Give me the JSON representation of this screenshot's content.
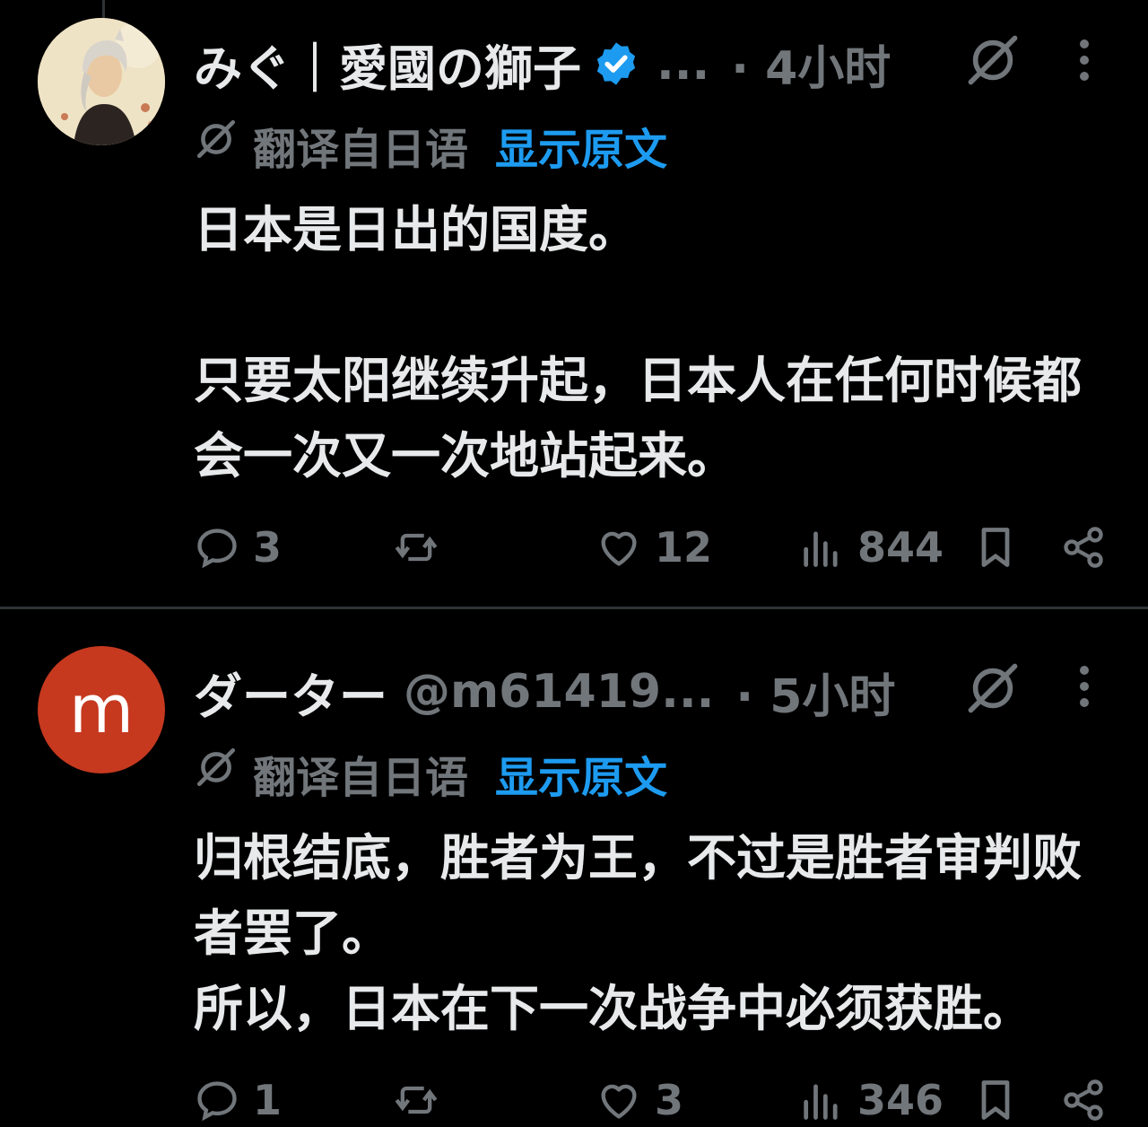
{
  "posts": [
    {
      "display_name": "みぐ｜愛國の獅子",
      "verified": true,
      "handle": "...",
      "timestamp": "· 4小时",
      "avatar_letter": "",
      "translated_label": "翻译自日语",
      "show_original_label": "显示原文",
      "paragraphs": [
        [
          "日本是日出的国度。"
        ],
        [
          "只要太阳继续升起，日本人在任何时候都",
          "会一次又一次地站起来。"
        ]
      ],
      "replies": "3",
      "reposts": "",
      "likes": "12",
      "views": "844"
    },
    {
      "display_name": "ダーター",
      "verified": false,
      "handle": "@m61419...",
      "timestamp": "· 5小时",
      "avatar_letter": "m",
      "translated_label": "翻译自日语",
      "show_original_label": "显示原文",
      "paragraphs": [
        [
          "归根结底，胜者为王，不过是胜者审判败",
          "者罢了。",
          "所以，日本在下一次战争中必须获胜。"
        ]
      ],
      "replies": "1",
      "reposts": "",
      "likes": "3",
      "views": "346"
    }
  ],
  "colors": {
    "background": "#000000",
    "text": "#e7e9ea",
    "muted": "#71767b",
    "link": "#1d9bf0",
    "verified": "#1d9bf0",
    "avatar_m": "#c6391f"
  }
}
